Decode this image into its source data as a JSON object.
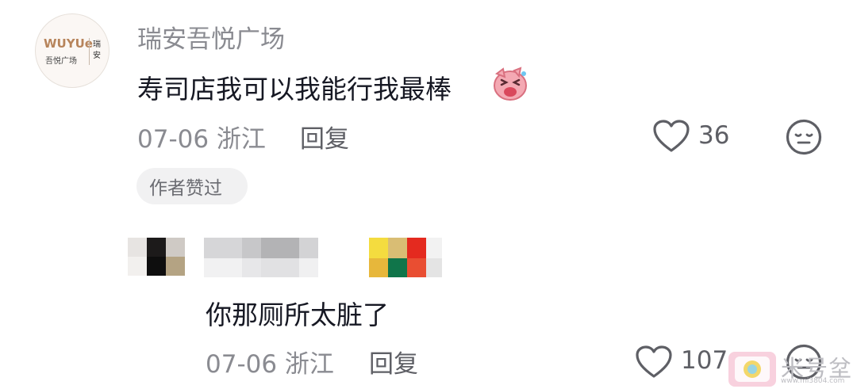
{
  "comment": {
    "avatar": {
      "brand": "WUYUe",
      "brand_sub": "吾悦广场",
      "city": "瑞安"
    },
    "username": "瑞安吾悦广场",
    "text": "寿司店我可以我能行我最棒",
    "emoji": "pig-laughing-emoji",
    "meta": "07-06 浙江",
    "reply_label": "回复",
    "like_count": "36",
    "badge": "作者赞过"
  },
  "reply": {
    "text": "你那厕所太脏了",
    "meta": "07-06 浙江",
    "reply_label": "回复",
    "like_count": "107"
  },
  "watermark": {
    "text": "米号坌",
    "url": "www.mi3804.com"
  },
  "colors": {
    "primary_text": "#161823",
    "secondary_text": "#8a8b91",
    "action_text": "#5e5f65",
    "badge_bg": "#f1f1f2"
  }
}
